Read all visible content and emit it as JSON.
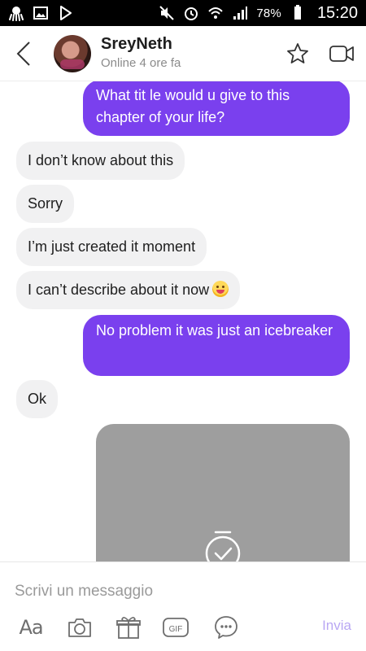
{
  "status_bar": {
    "battery": "78%",
    "time": "15:20",
    "left_icons": [
      "octopus-icon",
      "gallery-icon",
      "play-store-icon"
    ],
    "right_icons": [
      "mute-icon",
      "alarm-icon",
      "wifi-icon",
      "signal-icon",
      "battery-icon"
    ]
  },
  "header": {
    "name": "SreyNeth",
    "status": "Online 4 ore fa",
    "icons": [
      "back-icon",
      "star-icon",
      "video-call-icon"
    ]
  },
  "messages": [
    {
      "side": "out",
      "text": "What tit le would u give to this chapter of your life?"
    },
    {
      "side": "in",
      "text": "I don’t know about this"
    },
    {
      "side": "in",
      "text": "Sorry"
    },
    {
      "side": "in",
      "text": "I’m just created it moment"
    },
    {
      "side": "in",
      "text": "I can’t describe about it now",
      "emoji": "grinning-squint-face"
    },
    {
      "side": "out",
      "text": "No problem it was just an icebreaker"
    },
    {
      "side": "in",
      "text": "Ok"
    }
  ],
  "media": {
    "icon": "timer-check-icon"
  },
  "composer": {
    "placeholder": "Scrivi un messaggio",
    "value": "",
    "aa_label": "Aa",
    "gif_label": "GIF",
    "send_label": "Invia",
    "icons": [
      "text-style-icon",
      "camera-icon",
      "gift-icon",
      "gif-icon",
      "emoji-icon"
    ]
  },
  "colors": {
    "outgoing_bubble": "#7a40ee",
    "incoming_bubble": "#f1f1f2",
    "send_disabled": "#b9a7f3",
    "status_bar": "#000000"
  }
}
